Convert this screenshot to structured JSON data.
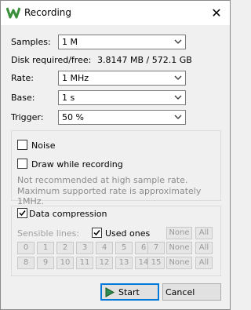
{
  "window": {
    "title": "Recording",
    "close_glyph": "✕",
    "icon": "app-logo-icon"
  },
  "samples": {
    "label": "Samples:",
    "value": "1 M"
  },
  "disk": {
    "label": "Disk required/free:",
    "value": "3.8147 MB / 572.1 GB"
  },
  "rate": {
    "label": "Rate:",
    "value": "1 MHz"
  },
  "base": {
    "label": "Base:",
    "value": "1 s"
  },
  "trigger": {
    "label": "Trigger:",
    "value": "50 %"
  },
  "options": {
    "noise": {
      "label": "Noise",
      "checked": false
    },
    "draw": {
      "label": "Draw while recording",
      "checked": false
    },
    "note_line1": "Not recommended at high sample rate.",
    "note_line2": "Maximum supported rate is approximately 1MHz."
  },
  "compression": {
    "label": "Data compression",
    "checked": true,
    "sensible_label": "Sensible lines:",
    "used_ones_label": "Used ones",
    "used_ones_checked": true,
    "lines_row1": [
      "0",
      "1",
      "2",
      "3",
      "4",
      "5",
      "6",
      "7"
    ],
    "lines_row2": [
      "8",
      "9",
      "10",
      "11",
      "12",
      "13",
      "14",
      "15"
    ],
    "none_label": "None",
    "all_label": "All"
  },
  "buttons": {
    "start": "Start",
    "cancel": "Cancel"
  },
  "colors": {
    "accent": "#0078d7",
    "brand": "#3a8f3a"
  }
}
